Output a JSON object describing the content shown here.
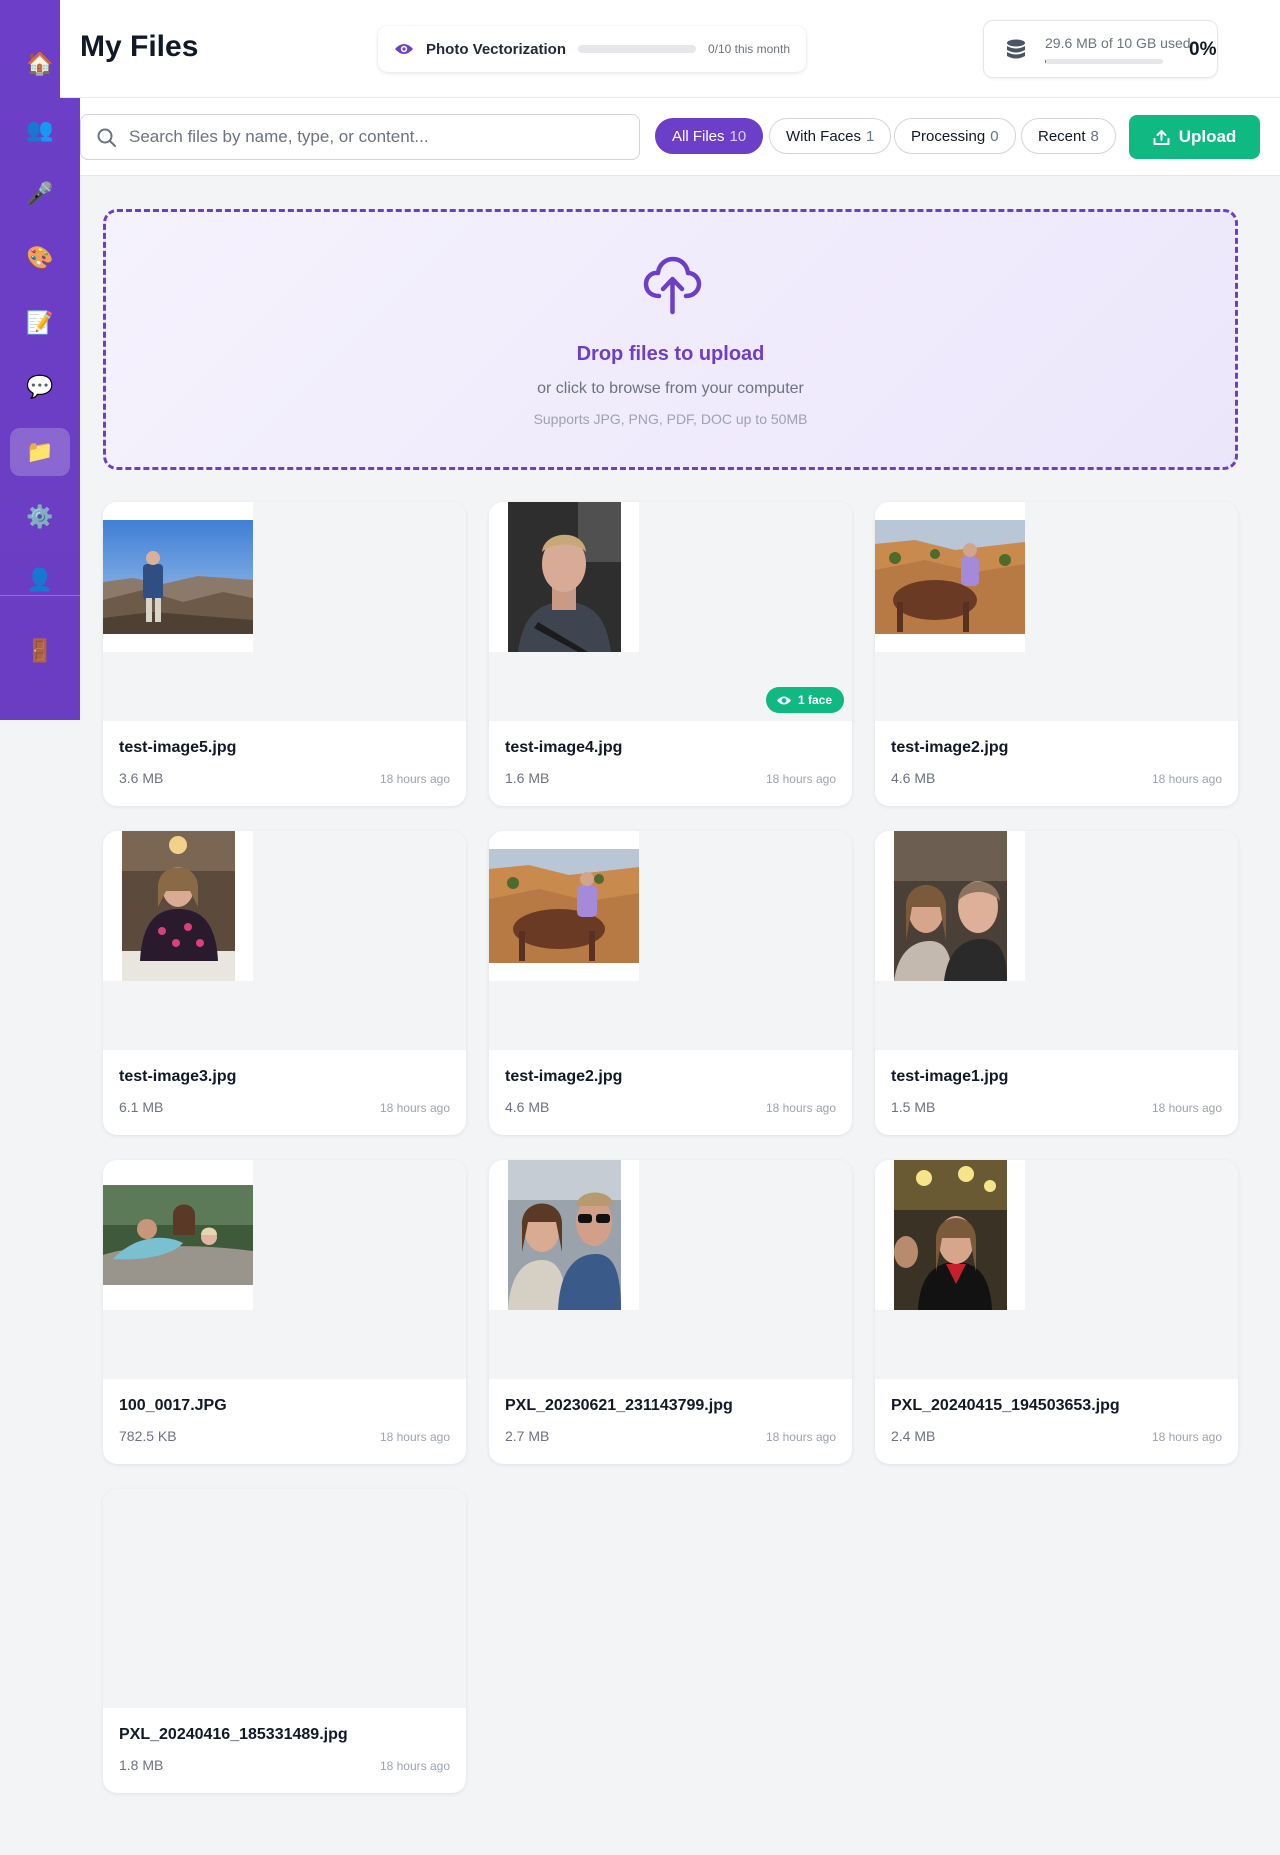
{
  "sidebar": {
    "items": [
      {
        "icon": "home-icon",
        "glyph": "🏠"
      },
      {
        "icon": "people-icon",
        "glyph": "👥"
      },
      {
        "icon": "microphone-icon",
        "glyph": "🎤"
      },
      {
        "icon": "palette-icon",
        "glyph": "🎨"
      },
      {
        "icon": "memo-icon",
        "glyph": "📝"
      },
      {
        "icon": "chat-icon",
        "glyph": "💬"
      },
      {
        "icon": "folder-icon",
        "glyph": "📁"
      },
      {
        "icon": "gear-icon",
        "glyph": "⚙️"
      },
      {
        "icon": "user-icon",
        "glyph": "👤"
      },
      {
        "icon": "door-icon",
        "glyph": "🚪"
      }
    ]
  },
  "header": {
    "title": "My Files",
    "quota": {
      "label": "Photo Vectorization",
      "count": "0/10 this month",
      "used_fraction": 0
    },
    "storage": {
      "text": "29.6 MB of 10 GB used",
      "percent": "0%",
      "used_fraction": 0.003
    }
  },
  "toolbar": {
    "search_placeholder": "Search files by name, type, or content...",
    "filters": [
      {
        "label": "All Files",
        "count": "10",
        "active": true
      },
      {
        "label": "With Faces",
        "count": "1",
        "active": false
      },
      {
        "label": "Processing",
        "count": "0",
        "active": false
      },
      {
        "label": "Recent",
        "count": "8",
        "active": false
      }
    ],
    "upload_label": "Upload"
  },
  "dropzone": {
    "title": "Drop files to upload",
    "subtitle": "or click to browse from your computer",
    "hint": "Supports JPG, PNG, PDF, DOC up to 50MB"
  },
  "files": [
    {
      "name": "test-image5.jpg",
      "size": "3.6 MB",
      "time": "18 hours ago"
    },
    {
      "name": "test-image4.jpg",
      "size": "1.6 MB",
      "time": "18 hours ago",
      "badge": "1 face"
    },
    {
      "name": "test-image2.jpg",
      "size": "4.6 MB",
      "time": "18 hours ago"
    },
    {
      "name": "test-image3.jpg",
      "size": "6.1 MB",
      "time": "18 hours ago"
    },
    {
      "name": "test-image2.jpg",
      "size": "4.6 MB",
      "time": "18 hours ago"
    },
    {
      "name": "test-image1.jpg",
      "size": "1.5 MB",
      "time": "18 hours ago"
    },
    {
      "name": "100_0017.JPG",
      "size": "782.5 KB",
      "time": "18 hours ago"
    },
    {
      "name": "PXL_20230621_231143799.jpg",
      "size": "2.7 MB",
      "time": "18 hours ago"
    },
    {
      "name": "PXL_20240415_194503653.jpg",
      "size": "2.4 MB",
      "time": "18 hours ago"
    },
    {
      "name": "PXL_20240416_185331489.jpg",
      "size": "1.8 MB",
      "time": "18 hours ago"
    }
  ],
  "colors": {
    "accent": "#6d3fc8",
    "success": "#10b981",
    "background": "#f3f4f6"
  }
}
